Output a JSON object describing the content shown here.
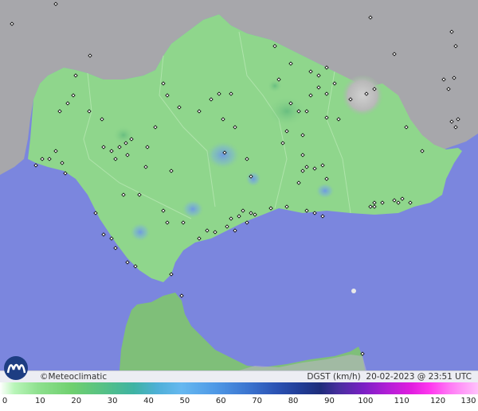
{
  "brand": "©Meteoclimatic",
  "caption": {
    "variable": "DGST (km/h)",
    "datetime": "20-02-2023 @ 23:51 UTC"
  },
  "colorbar": {
    "min": 0,
    "max": 130,
    "ticks": [
      "0",
      "10",
      "20",
      "30",
      "40",
      "50",
      "60",
      "70",
      "80",
      "90",
      "100",
      "110",
      "120",
      "130"
    ]
  },
  "colors": {
    "sea": "#7b86de",
    "land_other": "#a6a6a6",
    "region_low": "#92d98e",
    "region_mid": "#76c980",
    "gust_high": "#6fa0dc"
  }
}
